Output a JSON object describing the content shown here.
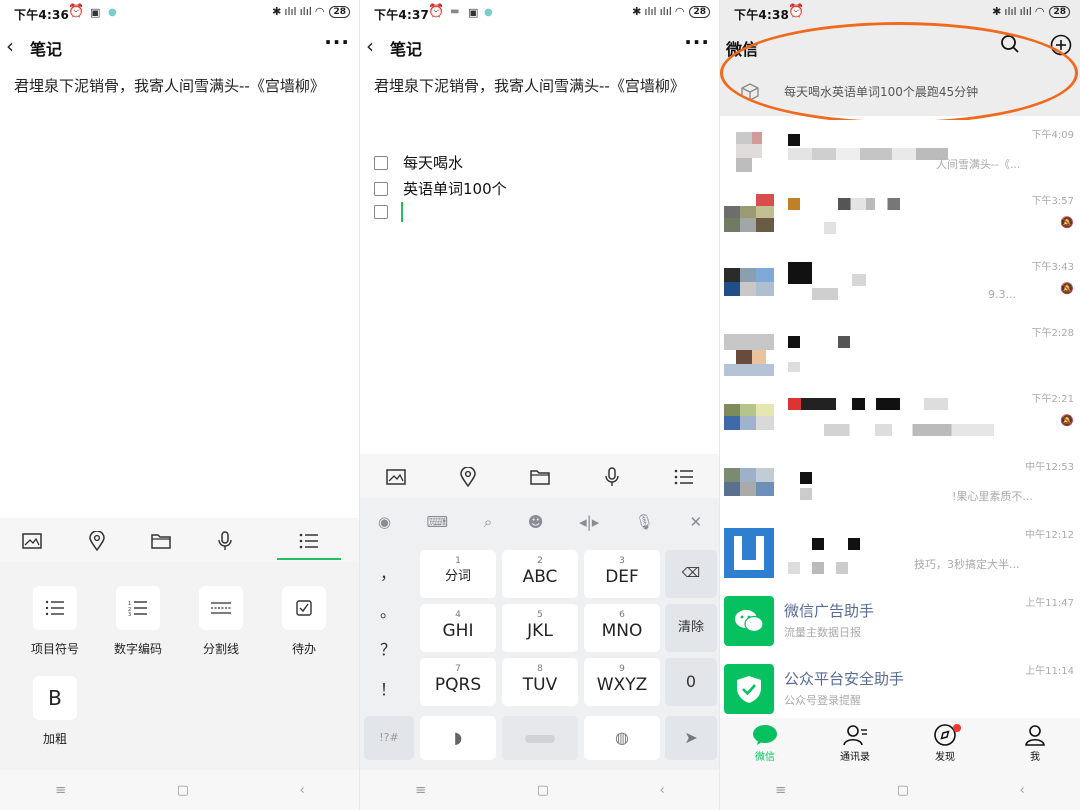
{
  "panel1": {
    "time": "下午4:36",
    "battery": "28",
    "title": "笔记",
    "note_text": "君埋泉下泥销骨，我寄人间雪满头--《宫墙柳》",
    "toolbar": [
      "image-icon",
      "location-icon",
      "folder-icon",
      "mic-icon",
      "list-icon"
    ],
    "menu": [
      "项目符号",
      "数字编码",
      "分割线",
      "待办",
      "加粗"
    ]
  },
  "panel2": {
    "time": "下午4:37",
    "battery": "28",
    "title": "笔记",
    "note_text": "君埋泉下泥销骨，我寄人间雪满头--《宫墙柳》",
    "todos": [
      "每天喝水",
      "英语单词100个",
      ""
    ],
    "keys": [
      {
        "num": "1",
        "label": "分词"
      },
      {
        "num": "2",
        "label": "ABC"
      },
      {
        "num": "3",
        "label": "DEF"
      },
      {
        "num": "4",
        "label": "GHI"
      },
      {
        "num": "5",
        "label": "JKL"
      },
      {
        "num": "6",
        "label": "MNO"
      },
      {
        "num": "7",
        "label": "PQRS"
      },
      {
        "num": "8",
        "label": "TUV"
      },
      {
        "num": "9",
        "label": "WXYZ"
      }
    ],
    "side_keys": [
      "，",
      "。",
      "？",
      "！"
    ],
    "clear_key": "清除",
    "zero_key": "0"
  },
  "panel3": {
    "time": "下午4:38",
    "battery": "28",
    "title": "微信",
    "search_text": "每天喝水英语单词100个晨跑45分钟",
    "chats": [
      {
        "time": "下午4:09",
        "name": "",
        "msg": "人间雪满头--《..."
      },
      {
        "time": "下午3:57",
        "name": "",
        "msg": ""
      },
      {
        "time": "下午3:43",
        "name": "",
        "msg": "9.3..."
      },
      {
        "time": "下午2:28",
        "name": "",
        "msg": ""
      },
      {
        "time": "下午2:21",
        "name": "",
        "msg": ""
      },
      {
        "time": "中午12:53",
        "name": "",
        "msg": "!果心里素质不..."
      },
      {
        "time": "中午12:12",
        "name": "",
        "msg": "技巧，3秒搞定大半..."
      },
      {
        "time": "上午11:47",
        "name": "微信广告助手",
        "msg": "流量主数据日报"
      },
      {
        "time": "上午11:14",
        "name": "公众平台安全助手",
        "msg": "公众号登录提醒"
      }
    ],
    "tabs": [
      "微信",
      "通讯录",
      "发现",
      "我"
    ],
    "colors": {
      "wechat_green": "#07c160",
      "annotation": "#ef6a1d"
    }
  }
}
